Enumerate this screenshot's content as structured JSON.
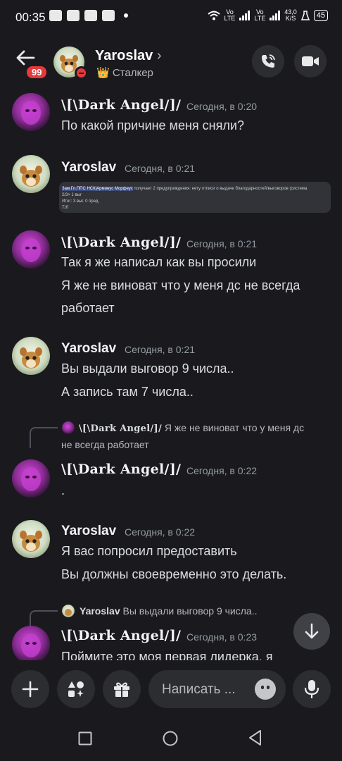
{
  "status_bar": {
    "time": "00:35",
    "network1": "Vo\nLTE",
    "network2": "Vo\nLTE",
    "speed": "43,0\nK/S",
    "battery": "45"
  },
  "header": {
    "back_icon": "arrow-left-icon",
    "unread_badge": "99",
    "name": "Yaroslav",
    "chevron": "›",
    "status_emoji": "👑",
    "status_text": "Сталкер",
    "call_icon": "phone-icon",
    "video_icon": "video-camera-icon"
  },
  "messages": [
    {
      "author": "\\[\\Dark Angel/]/",
      "timestamp": "Сегодня, в 0:20",
      "lines": [
        "По какой причине меня сняли?"
      ]
    },
    {
      "author": "Yaroslav",
      "timestamp": "Сегодня, в 0:21",
      "embed": {
        "line1_highlight": "Зам.Гл.ППС НСК|Арминус Морфеус",
        "line1_rest": " получает 2 предупреждения: нету отписи о выдаче благодарностей/выговоров (система",
        "line2": "2/3> 1 выг",
        "line3": "Итог: 3 выг. 0 пред.",
        "line4": "Т/Л"
      }
    },
    {
      "author": "\\[\\Dark Angel/]/",
      "timestamp": "Сегодня, в 0:21",
      "lines": [
        "Так я же написал как вы просили",
        "Я же не виноват что у меня дс не всегда",
        "работает"
      ]
    },
    {
      "author": "Yaroslav",
      "timestamp": "Сегодня, в 0:21",
      "lines": [
        "Вы выдали выговор 9 числа..",
        "А запись там 7 числа.."
      ]
    },
    {
      "reply_author": "\\[\\Dark Angel/]/",
      "reply_text_1": "Я же не виноват что у меня дс",
      "reply_text_2": "не всегда работает",
      "author": "\\[\\Dark Angel/]/",
      "timestamp": "Сегодня, в 0:22",
      "lines": [
        "."
      ]
    },
    {
      "author": "Yaroslav",
      "timestamp": "Сегодня, в 0:22",
      "lines": [
        "Я вас попросил предоставить",
        "Вы должны своевременно это делать."
      ]
    },
    {
      "reply_author": "Yaroslav",
      "reply_text_1": "Вы выдали выговор 9 числа..",
      "author": "\\[\\Dark Angel/]/",
      "timestamp": "Сегодня, в 0:23",
      "lines": [
        "Поймите это моя первая лидерка, я"
      ]
    }
  ],
  "composer": {
    "placeholder": "Написать ...",
    "plus_icon": "plus-icon",
    "apps_icon": "apps-icon",
    "gift_icon": "gift-icon",
    "emoji_icon": "emoji-icon",
    "mic_icon": "microphone-icon"
  },
  "colors": {
    "background": "#1a1a1e",
    "surface": "#2b2d31",
    "danger": "#e5393b",
    "muted_text": "#949ba4"
  }
}
